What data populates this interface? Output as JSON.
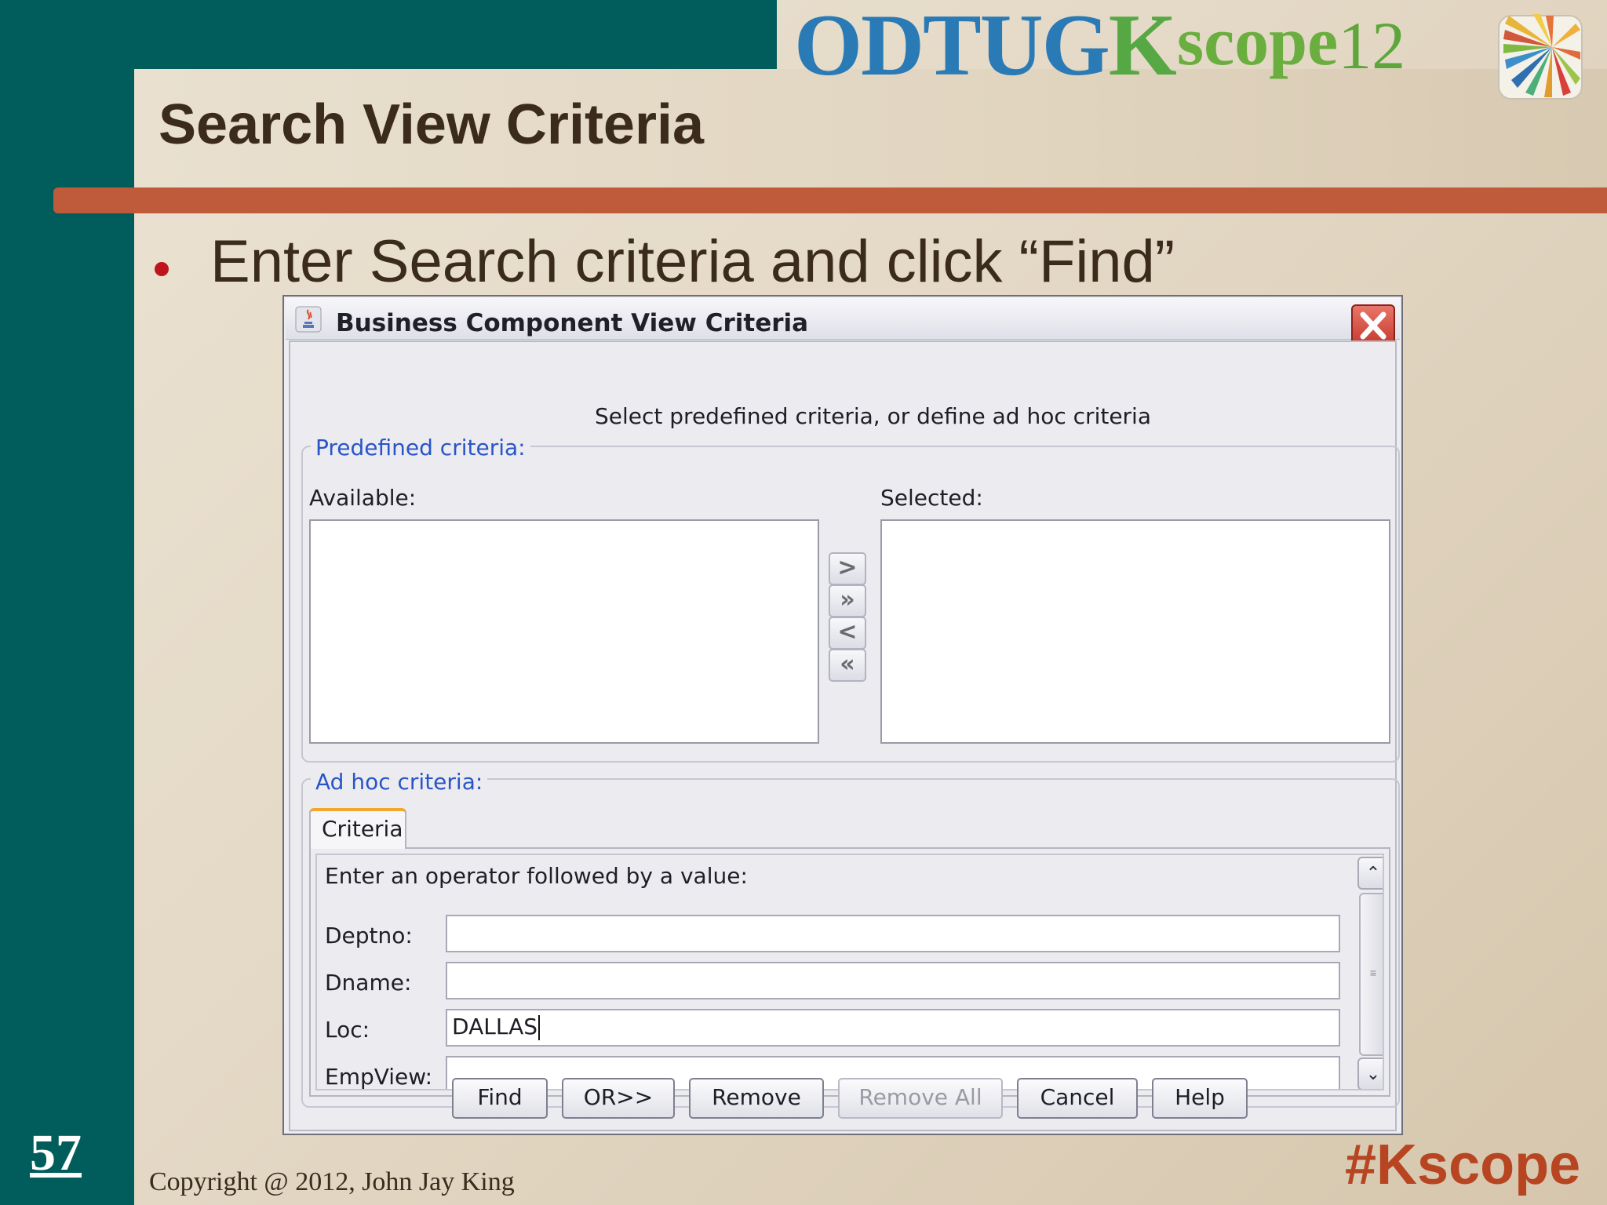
{
  "slide": {
    "title": "Search View Criteria",
    "bullet": "Enter Search criteria and click “Find”",
    "page_number": "57",
    "copyright": "Copyright @ 2012, John Jay King",
    "hashtag": "#Kscope"
  },
  "logo": {
    "odtug": "ODTUG",
    "k": "K",
    "scope": "scope",
    "year": "12",
    "icon": "kscope-sunburst-icon"
  },
  "dialog": {
    "title": "Business Component View Criteria",
    "instruction": "Select predefined criteria, or define ad hoc criteria",
    "predefined": {
      "legend": "Predefined criteria:",
      "available_label": "Available:",
      "selected_label": "Selected:",
      "move_buttons": [
        ">",
        "»",
        "<",
        "«"
      ]
    },
    "adhoc": {
      "legend": "Ad hoc criteria:",
      "tab": "Criteria",
      "hint": "Enter an operator followed by a value:",
      "fields": [
        {
          "label": "Deptno:",
          "value": ""
        },
        {
          "label": "Dname:",
          "value": ""
        },
        {
          "label": "Loc:",
          "value": "DALLAS"
        },
        {
          "label": "EmpView:",
          "value": ""
        }
      ]
    },
    "buttons": {
      "find": "Find",
      "or": "OR>>",
      "remove": "Remove",
      "remove_all": "Remove All",
      "cancel": "Cancel",
      "help": "Help"
    }
  },
  "colors": {
    "teal": "#015d5b",
    "rule": "#bf5a3b",
    "hashtag": "#b74521",
    "legend_blue": "#2a55c8"
  }
}
